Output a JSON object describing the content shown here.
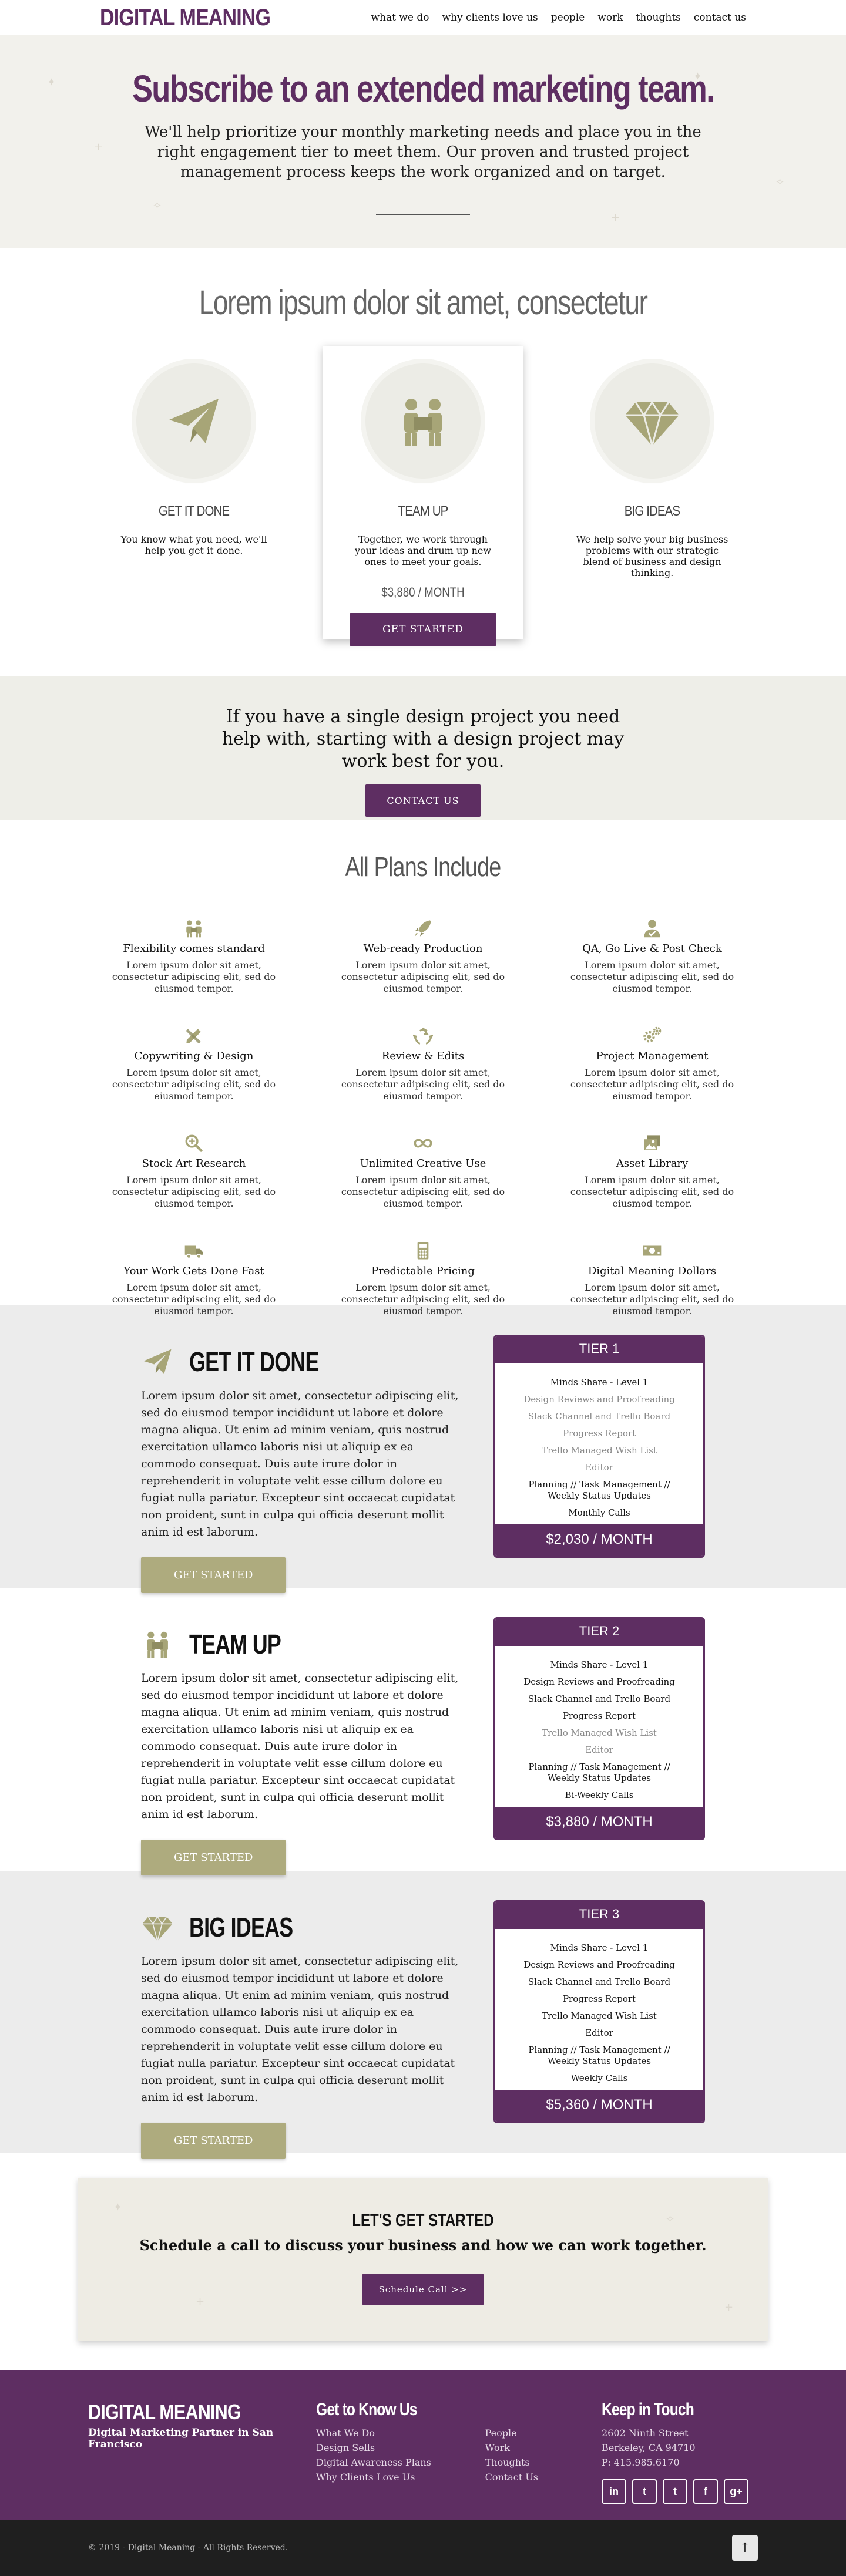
{
  "nav": {
    "logo": "DIGITAL MEANING",
    "links": [
      "what we do",
      "why clients love us",
      "people",
      "work",
      "thoughts",
      "contact us"
    ]
  },
  "hero": {
    "title": "Subscribe to an extended marketing team.",
    "body": "We'll help prioritize your monthly marketing needs and place you in the right engagement tier to meet them. Our proven and trusted project management process keeps the work organized and on target."
  },
  "intro": {
    "heading": "Lorem ipsum dolor sit amet, consectetur",
    "tiers": [
      {
        "icon": "paper-plane-icon",
        "title": "GET IT DONE",
        "text": "You know what you need, we'll help you get it done."
      },
      {
        "icon": "team-up-icon",
        "title": "TEAM UP",
        "text": "Together, we work through your ideas and drum up new ones to meet your goals.",
        "price": "$3,880 / MONTH",
        "button": "GET STARTED"
      },
      {
        "icon": "diamond-icon",
        "title": "BIG IDEAS",
        "text": "We help solve your big business problems with our strategic blend of business and design thinking."
      }
    ]
  },
  "single": {
    "text": "If you have a single design project you need help with, starting with a design project may work best for you.",
    "button": "CONTACT US"
  },
  "plans": {
    "heading": "All Plans Include",
    "items": [
      {
        "icon": "people-icon",
        "title": "Flexibility comes standard",
        "text": "Lorem ipsum dolor sit amet, consectetur adipiscing elit, sed do eiusmod tempor."
      },
      {
        "icon": "rocket-icon",
        "title": "Web-ready Production",
        "text": "Lorem ipsum dolor sit amet, consectetur adipiscing elit, sed do eiusmod tempor."
      },
      {
        "icon": "user-check-icon",
        "title": "QA, Go Live & Post Check",
        "text": "Lorem ipsum dolor sit amet, consectetur adipiscing elit, sed do eiusmod tempor."
      },
      {
        "icon": "pencil-ruler-icon",
        "title": "Copywriting & Design",
        "text": "Lorem ipsum dolor sit amet, consectetur adipiscing elit, sed do eiusmod tempor."
      },
      {
        "icon": "recycle-icon",
        "title": "Review & Edits",
        "text": "Lorem ipsum dolor sit amet, consectetur adipiscing elit, sed do eiusmod tempor."
      },
      {
        "icon": "gears-icon",
        "title": "Project Management",
        "text": "Lorem ipsum dolor sit amet, consectetur adipiscing elit, sed do eiusmod tempor."
      },
      {
        "icon": "magnifier-icon",
        "title": "Stock Art Research",
        "text": "Lorem ipsum dolor sit amet, consectetur adipiscing elit, sed do eiusmod tempor."
      },
      {
        "icon": "infinity-icon",
        "title": "Unlimited Creative Use",
        "text": "Lorem ipsum dolor sit amet, consectetur adipiscing elit, sed do eiusmod tempor."
      },
      {
        "icon": "images-icon",
        "title": "Asset Library",
        "text": "Lorem ipsum dolor sit amet, consectetur adipiscing elit, sed do eiusmod tempor."
      },
      {
        "icon": "truck-icon",
        "title": "Your Work Gets Done Fast",
        "text": "Lorem ipsum dolor sit amet, consectetur adipiscing elit, sed do eiusmod tempor."
      },
      {
        "icon": "calculator-icon",
        "title": "Predictable Pricing",
        "text": "Lorem ipsum dolor sit amet, consectetur adipiscing elit, sed do eiusmod tempor."
      },
      {
        "icon": "money-icon",
        "title": "Digital Meaning Dollars",
        "text": "Lorem ipsum dolor sit amet, consectetur adipiscing elit, sed do eiusmod tempor."
      }
    ]
  },
  "details": [
    {
      "icon": "paper-plane-icon",
      "title": "GET IT DONE",
      "body": "Lorem ipsum dolor sit amet, consectetur adipiscing elit, sed do eiusmod tempor incididunt ut labore et dolore magna aliqua. Ut enim ad minim veniam, quis nostrud exercitation ullamco laboris nisi ut aliquip ex ea commodo consequat. Duis aute irure dolor in reprehenderit in voluptate velit esse cillum dolore eu fugiat nulla pariatur. Excepteur sint occaecat cupidatat non proident, sunt in culpa qui officia deserunt mollit anim id est laborum.",
      "button": "GET STARTED",
      "card": {
        "tier": "TIER 1",
        "items": [
          {
            "label": "Minds Share - Level 1",
            "on": true
          },
          {
            "label": "Design Reviews and Proofreading",
            "on": false
          },
          {
            "label": "Slack Channel and Trello Board",
            "on": false
          },
          {
            "label": "Progress Report",
            "on": false
          },
          {
            "label": "Trello Managed Wish List",
            "on": false
          },
          {
            "label": "Editor",
            "on": false
          },
          {
            "label": "Planning // Task Management // Weekly Status Updates",
            "on": true
          },
          {
            "label": "Monthly Calls",
            "on": true
          }
        ],
        "price": "$2,030 / MONTH"
      }
    },
    {
      "icon": "team-up-icon",
      "title": "TEAM UP",
      "body": "Lorem ipsum dolor sit amet, consectetur adipiscing elit, sed do eiusmod tempor incididunt ut labore et dolore magna aliqua. Ut enim ad minim veniam, quis nostrud exercitation ullamco laboris nisi ut aliquip ex ea commodo consequat. Duis aute irure dolor in reprehenderit in voluptate velit esse cillum dolore eu fugiat nulla pariatur. Excepteur sint occaecat cupidatat non proident, sunt in culpa qui officia deserunt mollit anim id est laborum.",
      "button": "GET STARTED",
      "card": {
        "tier": "TIER 2",
        "items": [
          {
            "label": "Minds Share - Level 1",
            "on": true
          },
          {
            "label": "Design Reviews and Proofreading",
            "on": true
          },
          {
            "label": "Slack Channel and Trello Board",
            "on": true
          },
          {
            "label": "Progress Report",
            "on": true
          },
          {
            "label": "Trello Managed Wish List",
            "on": false
          },
          {
            "label": "Editor",
            "on": false
          },
          {
            "label": "Planning // Task Management // Weekly Status Updates",
            "on": true
          },
          {
            "label": "Bi-Weekly Calls",
            "on": true
          }
        ],
        "price": "$3,880 / MONTH"
      }
    },
    {
      "icon": "diamond-icon",
      "title": "BIG IDEAS",
      "body": "Lorem ipsum dolor sit amet, consectetur adipiscing elit, sed do eiusmod tempor incididunt ut labore et dolore magna aliqua. Ut enim ad minim veniam, quis nostrud exercitation ullamco laboris nisi ut aliquip ex ea commodo consequat. Duis aute irure dolor in reprehenderit in voluptate velit esse cillum dolore eu fugiat nulla pariatur. Excepteur sint occaecat cupidatat non proident, sunt in culpa qui officia deserunt mollit anim id est laborum.",
      "button": "GET STARTED",
      "card": {
        "tier": "TIER 3",
        "items": [
          {
            "label": "Minds Share - Level 1",
            "on": true
          },
          {
            "label": "Design Reviews and Proofreading",
            "on": true
          },
          {
            "label": "Slack Channel and Trello Board",
            "on": true
          },
          {
            "label": "Progress Report",
            "on": true
          },
          {
            "label": "Trello Managed Wish List",
            "on": true
          },
          {
            "label": "Editor",
            "on": true
          },
          {
            "label": "Planning // Task Management // Weekly Status Updates",
            "on": true
          },
          {
            "label": "Weekly Calls",
            "on": true
          }
        ],
        "price": "$5,360 / MONTH"
      }
    }
  ],
  "cta": {
    "title": "LET'S GET STARTED",
    "text": "Schedule a call to discuss your business and how we can work together.",
    "button": "Schedule Call >>"
  },
  "footer": {
    "logo": "DIGITAL MEANING",
    "tagline": "Digital Marketing Partner in San Francisco",
    "know_heading": "Get to Know Us",
    "links_a": [
      "What We Do",
      "Design Sells",
      "Digital Awareness Plans",
      "Why Clients Love Us"
    ],
    "links_b": [
      "People",
      "Work",
      "Thoughts",
      "Contact Us"
    ],
    "touch_heading": "Keep in Touch",
    "address": [
      "2602 Ninth Street",
      "Berkeley, CA 94710",
      "P: 415.985.6170"
    ],
    "social": [
      "in",
      "t",
      "t",
      "f",
      "g+"
    ],
    "copyright": "© 2019 - Digital Meaning - All Rights Reserved."
  },
  "colors": {
    "primary": "#5e2e62",
    "olive": "#aeab7e",
    "icon": "#a7a577"
  }
}
